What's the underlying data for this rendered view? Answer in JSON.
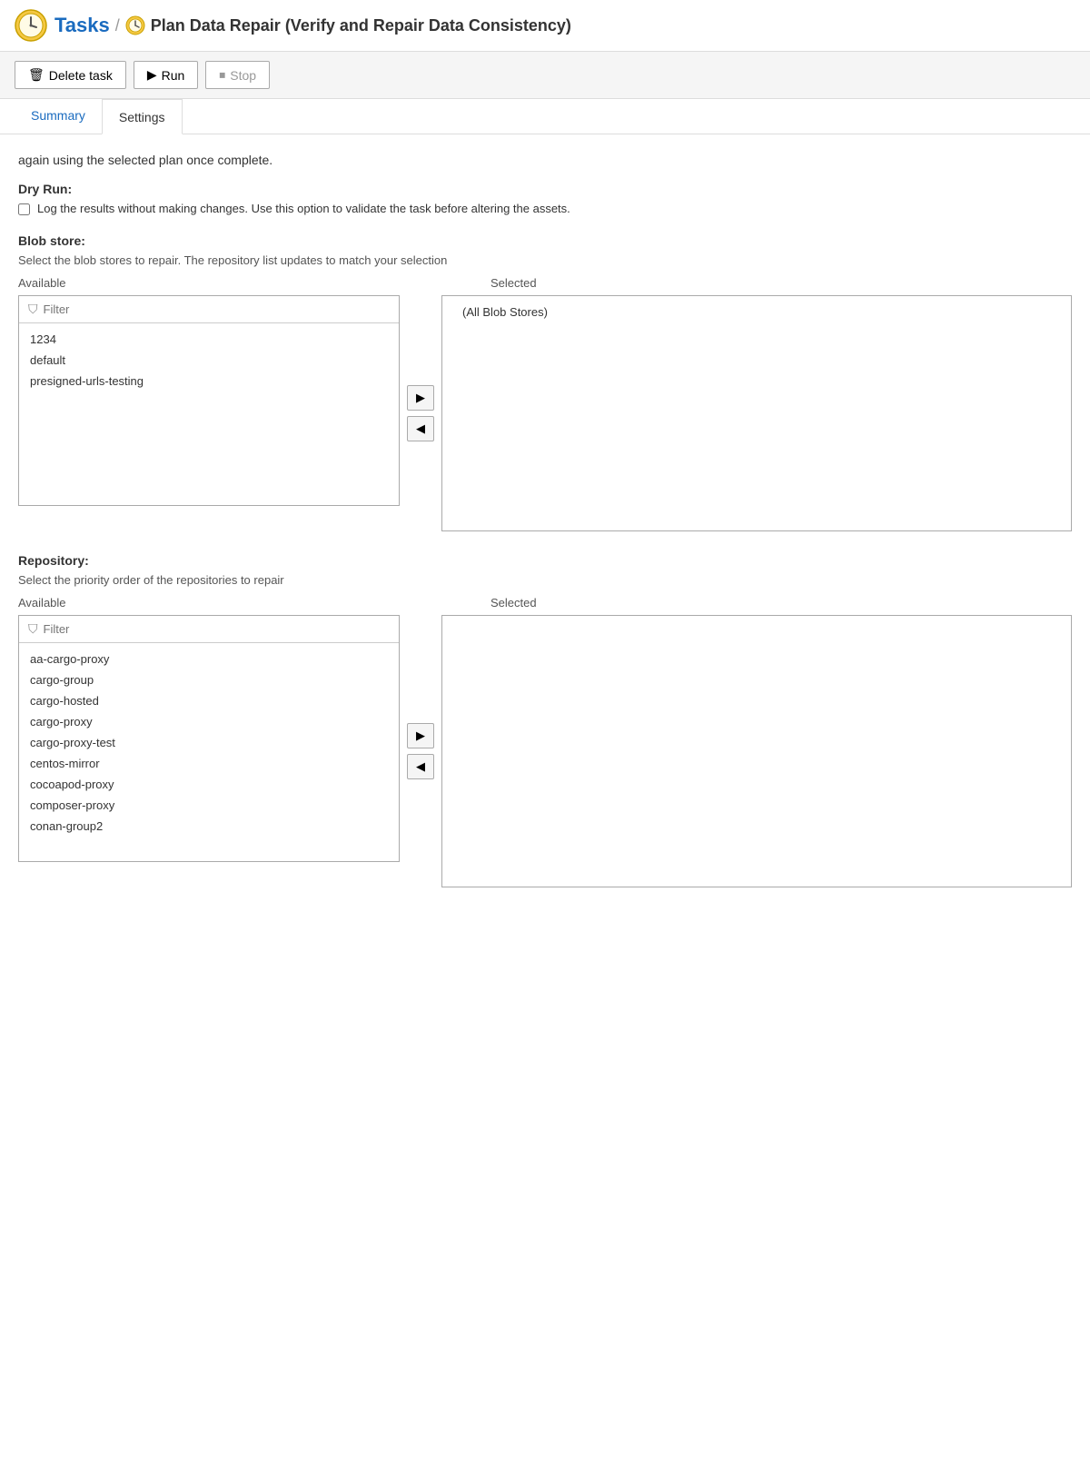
{
  "header": {
    "tasks_label": "Tasks",
    "separator": "/",
    "page_title": "Plan Data Repair (Verify and Repair Data Consistency)"
  },
  "toolbar": {
    "delete_label": "Delete task",
    "run_label": "Run",
    "stop_label": "Stop"
  },
  "tabs": [
    {
      "id": "summary",
      "label": "Summary",
      "active": false
    },
    {
      "id": "settings",
      "label": "Settings",
      "active": true
    }
  ],
  "content": {
    "intro_text": "again using the selected plan once complete.",
    "dry_run": {
      "label": "Dry Run:",
      "checkbox_label": "Log the results without making changes. Use this option to validate the task before altering the assets."
    },
    "blob_store": {
      "label": "Blob store:",
      "description": "Select the blob stores to repair. The repository list updates to match your selection",
      "available_label": "Available",
      "selected_label": "Selected",
      "filter_placeholder": "Filter",
      "available_items": [
        "1234",
        "default",
        "presigned-urls-testing"
      ],
      "selected_items": [
        "(All Blob Stores)"
      ],
      "move_right_label": "▶",
      "move_left_label": "◀"
    },
    "repository": {
      "label": "Repository:",
      "description": "Select the priority order of the repositories to repair",
      "available_label": "Available",
      "selected_label": "Selected",
      "filter_placeholder": "Filter",
      "available_items": [
        "aa-cargo-proxy",
        "cargo-group",
        "cargo-hosted",
        "cargo-proxy",
        "cargo-proxy-test",
        "centos-mirror",
        "cocoapod-proxy",
        "composer-proxy",
        "conan-group2"
      ],
      "selected_items": [],
      "move_right_label": "▶",
      "move_left_label": "◀"
    }
  }
}
